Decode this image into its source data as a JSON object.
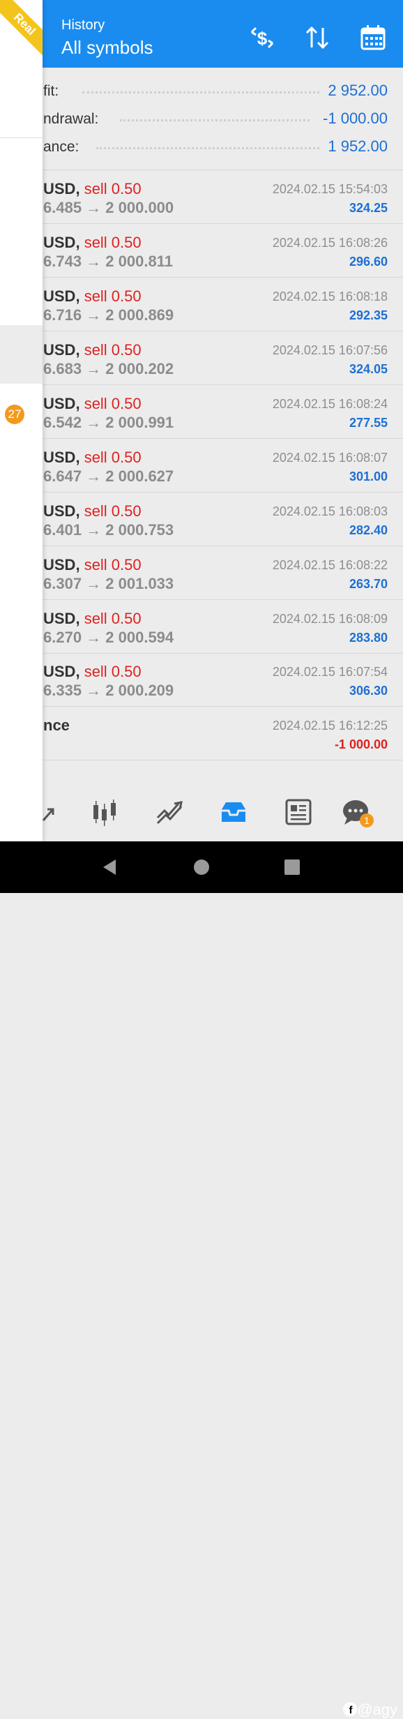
{
  "header": {
    "title_small": "History",
    "title_big": "All symbols",
    "icons": [
      "exchange-dollar-icon",
      "sort-icon",
      "calendar-icon"
    ]
  },
  "summary": {
    "profit_label": "fit:",
    "profit_value": "2 952.00",
    "withdrawal_label": "ndrawal:",
    "withdrawal_value": "-1 000.00",
    "balance_label": "ance:",
    "balance_value": "1 952.00"
  },
  "deals": [
    {
      "symbol": "USD,",
      "type": "sell 0.50",
      "prices": "6.485 → 2 000.000",
      "date": "2024.02.15 15:54:03",
      "profit": "324.25"
    },
    {
      "symbol": "USD,",
      "type": "sell 0.50",
      "prices": "6.743 → 2 000.811",
      "date": "2024.02.15 16:08:26",
      "profit": "296.60"
    },
    {
      "symbol": "USD,",
      "type": "sell 0.50",
      "prices": "6.716 → 2 000.869",
      "date": "2024.02.15 16:08:18",
      "profit": "292.35"
    },
    {
      "symbol": "USD,",
      "type": "sell 0.50",
      "prices": "6.683 → 2 000.202",
      "date": "2024.02.15 16:07:56",
      "profit": "324.05"
    },
    {
      "symbol": "USD,",
      "type": "sell 0.50",
      "prices": "6.542 → 2 000.991",
      "date": "2024.02.15 16:08:24",
      "profit": "277.55"
    },
    {
      "symbol": "USD,",
      "type": "sell 0.50",
      "prices": "6.647 → 2 000.627",
      "date": "2024.02.15 16:08:07",
      "profit": "301.00"
    },
    {
      "symbol": "USD,",
      "type": "sell 0.50",
      "prices": "6.401 → 2 000.753",
      "date": "2024.02.15 16:08:03",
      "profit": "282.40"
    },
    {
      "symbol": "USD,",
      "type": "sell 0.50",
      "prices": "6.307 → 2 001.033",
      "date": "2024.02.15 16:08:22",
      "profit": "263.70"
    },
    {
      "symbol": "USD,",
      "type": "sell 0.50",
      "prices": "6.270 → 2 000.594",
      "date": "2024.02.15 16:08:09",
      "profit": "283.80"
    },
    {
      "symbol": "USD,",
      "type": "sell 0.50",
      "prices": "6.335 → 2 000.209",
      "date": "2024.02.15 16:07:54",
      "profit": "306.30"
    }
  ],
  "balance_op": {
    "label": "nce",
    "date": "2024.02.15 16:12:25",
    "amount": "-1 000.00"
  },
  "drawer": {
    "ribbon": "Real",
    "badge": "27"
  },
  "bottom_nav": {
    "icons": [
      "trade-icon",
      "candlestick-chart-icon",
      "trend-chart-icon",
      "history-inbox-icon",
      "news-icon",
      "chat-icon"
    ],
    "chat_badge": "1",
    "active": "history-inbox-icon"
  },
  "system_nav": {
    "icons": [
      "back-icon",
      "home-icon",
      "recents-icon"
    ]
  },
  "watermark": "@agy",
  "colors": {
    "accent": "#1a8cf0",
    "profit": "#1d6fd3",
    "loss": "#dd2222",
    "badge": "#f29a1c",
    "ribbon": "#f3c51c"
  }
}
